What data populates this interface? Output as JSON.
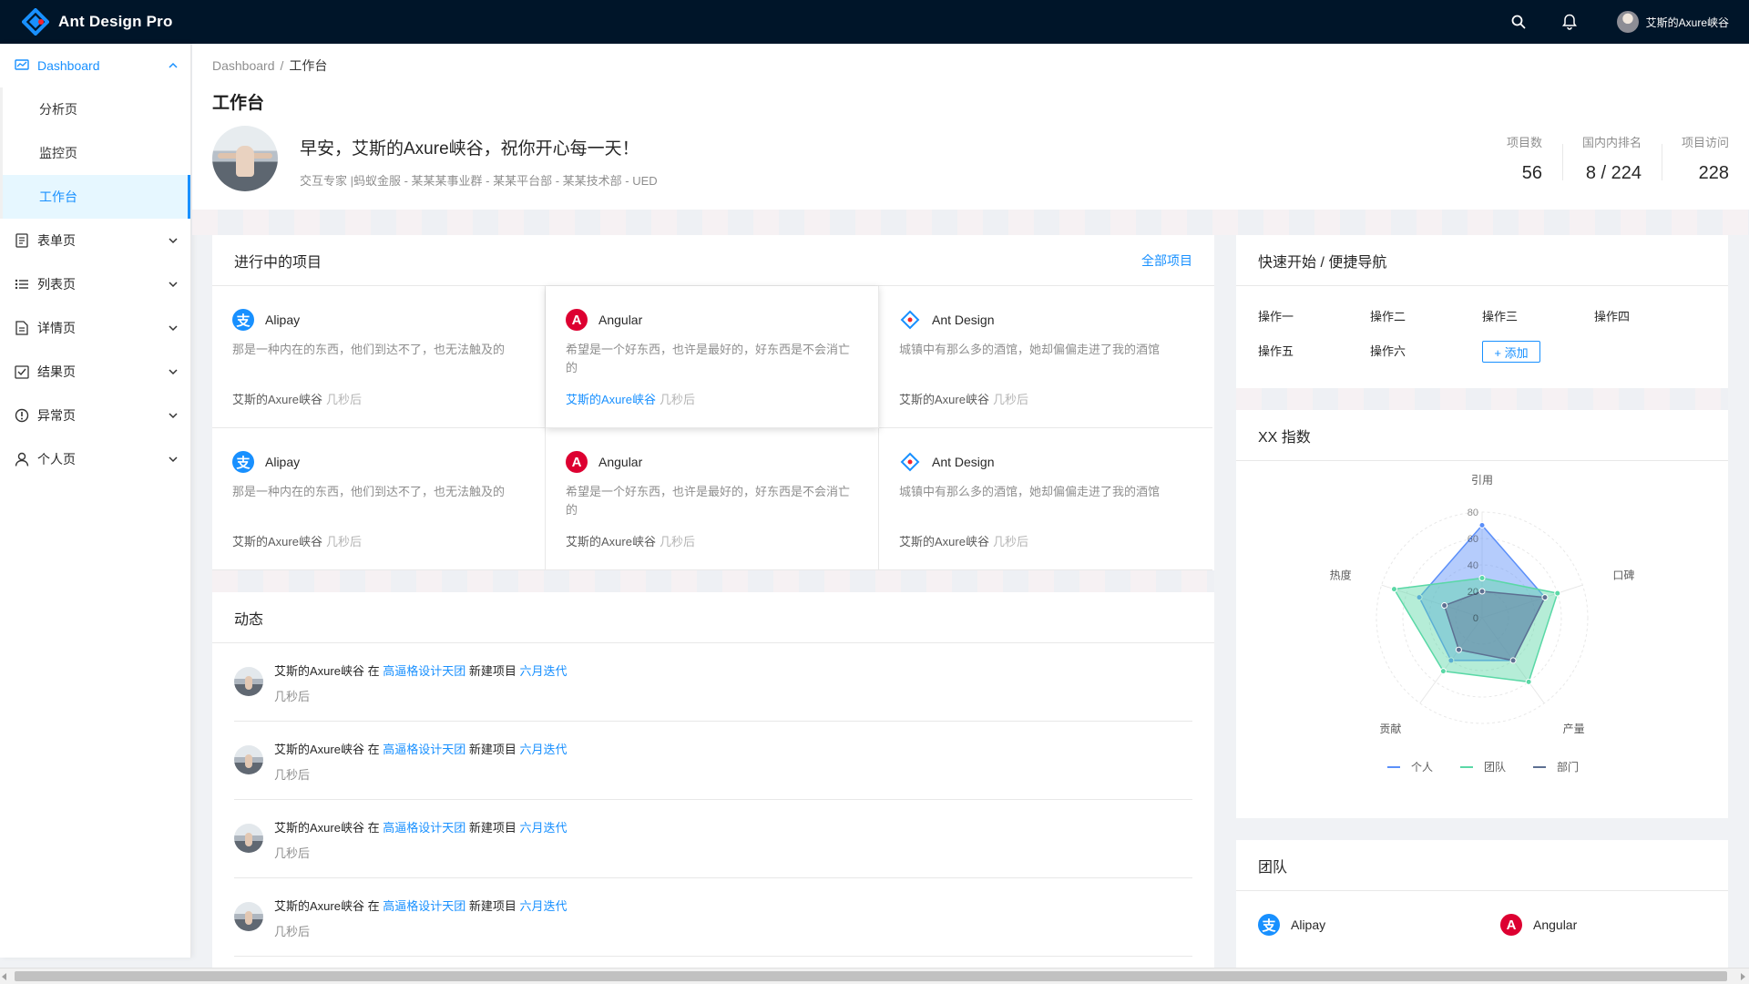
{
  "app": {
    "title": "Ant Design Pro"
  },
  "header": {
    "user_name": "艾斯的Axure峡谷"
  },
  "sidebar": {
    "dashboard": {
      "label": "Dashboard",
      "items": [
        "分析页",
        "监控页",
        "工作台"
      ]
    },
    "groups": [
      {
        "label": "表单页",
        "icon": "form-icon"
      },
      {
        "label": "列表页",
        "icon": "list-icon"
      },
      {
        "label": "详情页",
        "icon": "profile-icon"
      },
      {
        "label": "结果页",
        "icon": "check-square-icon"
      },
      {
        "label": "异常页",
        "icon": "warning-icon"
      },
      {
        "label": "个人页",
        "icon": "user-icon"
      }
    ]
  },
  "breadcrumb": {
    "root": "Dashboard",
    "sep": "/",
    "current": "工作台"
  },
  "page": {
    "title": "工作台",
    "greeting": "早安，艾斯的Axure峡谷，祝你开心每一天！",
    "subtitle": "交互专家 |蚂蚁金服 - 某某某事业群 - 某某平台部 - 某某技术部 - UED"
  },
  "stats": [
    {
      "label": "项目数",
      "value": "56"
    },
    {
      "label": "国内内排名",
      "value": "8 / 224"
    },
    {
      "label": "项目访问",
      "value": "228"
    }
  ],
  "projects": {
    "title": "进行中的项目",
    "extra": "全部项目",
    "items": [
      {
        "name": "Alipay",
        "desc": "那是一种内在的东西，他们到达不了，也无法触及的",
        "owner": "艾斯的Axure峡谷",
        "time": "几秒后"
      },
      {
        "name": "Angular",
        "desc": "希望是一个好东西，也许是最好的，好东西是不会消亡的",
        "owner": "艾斯的Axure峡谷",
        "time": "几秒后"
      },
      {
        "name": "Ant Design",
        "desc": "城镇中有那么多的酒馆，她却偏偏走进了我的酒馆",
        "owner": "艾斯的Axure峡谷",
        "time": "几秒后"
      },
      {
        "name": "Alipay",
        "desc": "那是一种内在的东西，他们到达不了，也无法触及的",
        "owner": "艾斯的Axure峡谷",
        "time": "几秒后"
      },
      {
        "name": "Angular",
        "desc": "希望是一个好东西，也许是最好的，好东西是不会消亡的",
        "owner": "艾斯的Axure峡谷",
        "time": "几秒后"
      },
      {
        "name": "Ant Design",
        "desc": "城镇中有那么多的酒馆，她却偏偏走进了我的酒馆",
        "owner": "艾斯的Axure峡谷",
        "time": "几秒后"
      }
    ]
  },
  "activity": {
    "title": "动态",
    "items": [
      {
        "user": "艾斯的Axure峡谷",
        "at": "在",
        "group": "高逼格设计天团",
        "action": "新建项目",
        "project": "六月迭代",
        "time": "几秒后"
      },
      {
        "user": "艾斯的Axure峡谷",
        "at": "在",
        "group": "高逼格设计天团",
        "action": "新建项目",
        "project": "六月迭代",
        "time": "几秒后"
      },
      {
        "user": "艾斯的Axure峡谷",
        "at": "在",
        "group": "高逼格设计天团",
        "action": "新建项目",
        "project": "六月迭代",
        "time": "几秒后"
      },
      {
        "user": "艾斯的Axure峡谷",
        "at": "在",
        "group": "高逼格设计天团",
        "action": "新建项目",
        "project": "六月迭代",
        "time": "几秒后"
      }
    ]
  },
  "quick": {
    "title": "快速开始 / 便捷导航",
    "links": [
      "操作一",
      "操作二",
      "操作三",
      "操作四",
      "操作五",
      "操作六"
    ],
    "add_label": "+ 添加"
  },
  "radar": {
    "title": "XX 指数",
    "legend": [
      "个人",
      "团队",
      "部门"
    ]
  },
  "chart_data": {
    "type": "radar",
    "categories": [
      "引用",
      "口碑",
      "产量",
      "贡献",
      "热度"
    ],
    "ticks": [
      "80",
      "60",
      "40",
      "20",
      "0"
    ],
    "rlim": [
      0,
      80
    ],
    "series": [
      {
        "name": "个人",
        "color": "#5b8ff9",
        "values": [
          70,
          50,
          40,
          40,
          50
        ]
      },
      {
        "name": "团队",
        "color": "#5ad8a6",
        "values": [
          30,
          60,
          60,
          50,
          70
        ]
      },
      {
        "name": "部门",
        "color": "#5d7092",
        "values": [
          20,
          50,
          40,
          30,
          30
        ]
      }
    ],
    "legend_position": "bottom"
  },
  "team": {
    "title": "团队",
    "items": [
      {
        "name": "Alipay"
      },
      {
        "name": "Angular"
      }
    ]
  },
  "colors": {
    "primary": "#1890ff",
    "header_bg": "#001529",
    "alipay": "#1890ff",
    "angular": "#dd0031"
  }
}
